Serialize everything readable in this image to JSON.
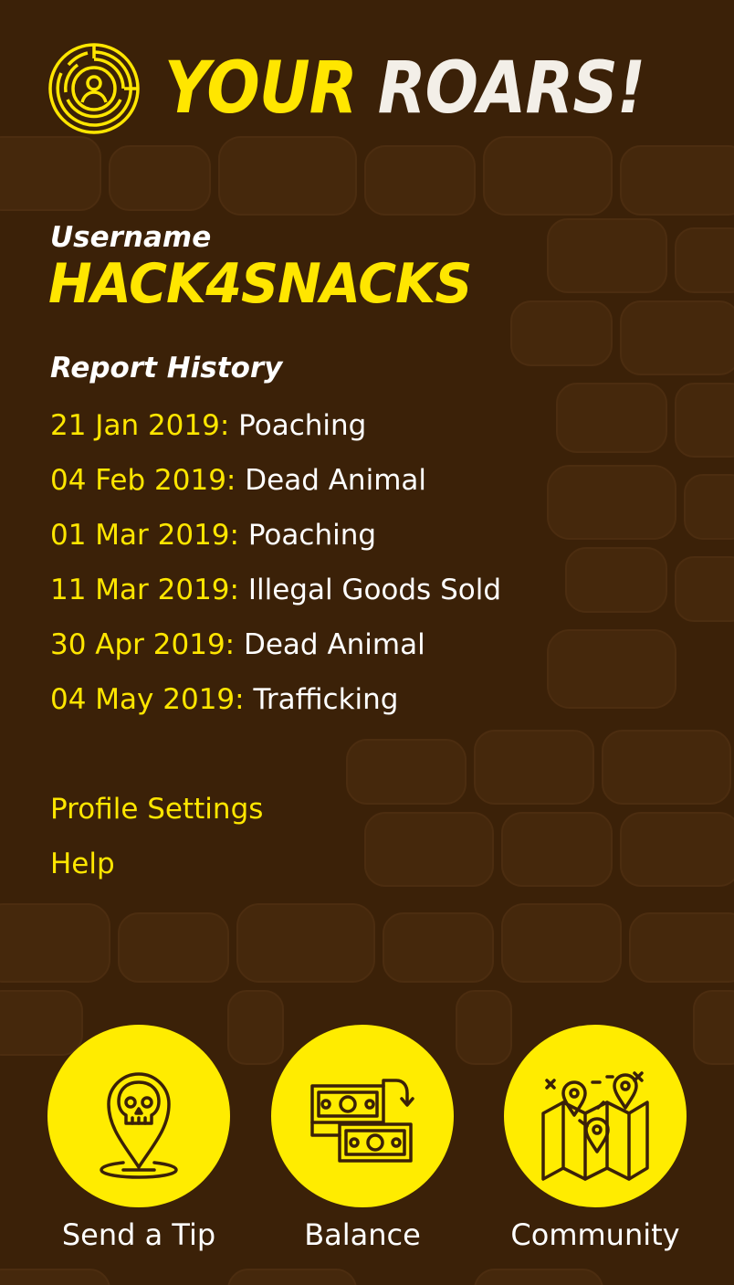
{
  "header": {
    "title_part1": "YOUR",
    "title_part2": "ROARS!",
    "logo_icon": "target-user-icon"
  },
  "profile": {
    "username_label": "Username",
    "username": "HACK4SNACKS"
  },
  "report_history": {
    "label": "Report History",
    "items": [
      {
        "date": "21 Jan 2019:",
        "type": "Poaching"
      },
      {
        "date": "04 Feb 2019:",
        "type": "Dead Animal"
      },
      {
        "date": "01 Mar 2019:",
        "type": "Poaching"
      },
      {
        "date": "11 Mar 2019:",
        "type": "Illegal Goods Sold"
      },
      {
        "date": "30 Apr 2019:",
        "type": "Dead Animal"
      },
      {
        "date": "04 May 2019:",
        "type": "Trafficking"
      }
    ]
  },
  "links": {
    "profile_settings": "Profile Settings",
    "help": "Help"
  },
  "bottom_nav": {
    "send_tip": {
      "label": "Send a Tip",
      "icon": "skull-pin-icon"
    },
    "balance": {
      "label": "Balance",
      "icon": "money-transfer-icon"
    },
    "community": {
      "label": "Community",
      "icon": "map-pins-icon"
    }
  },
  "colors": {
    "background": "#3b2108",
    "accent_yellow": "#ffe600",
    "text_white": "#ffffff"
  }
}
